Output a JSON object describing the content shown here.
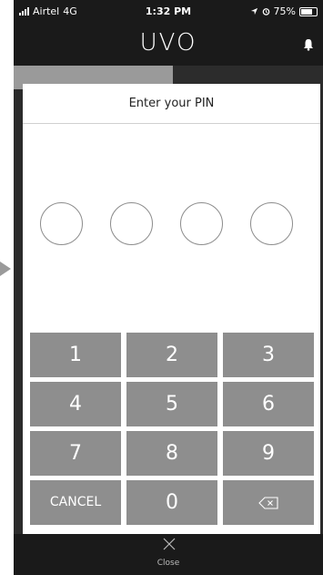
{
  "status_bar": {
    "carrier": "Airtel",
    "network": "4G",
    "time": "1:32 PM",
    "battery": "75%"
  },
  "header": {
    "logo": "UVO"
  },
  "modal": {
    "title": "Enter your PIN",
    "pin_slots": 4
  },
  "keypad": {
    "keys": [
      "1",
      "2",
      "3",
      "4",
      "5",
      "6",
      "7",
      "8",
      "9"
    ],
    "cancel_label": "CANCEL",
    "zero_label": "0"
  },
  "footer": {
    "close_label": "Close"
  },
  "colors": {
    "key_bg": "#8e8e8e",
    "app_bg": "#1a1a1a",
    "modal_bg": "#ffffff"
  }
}
